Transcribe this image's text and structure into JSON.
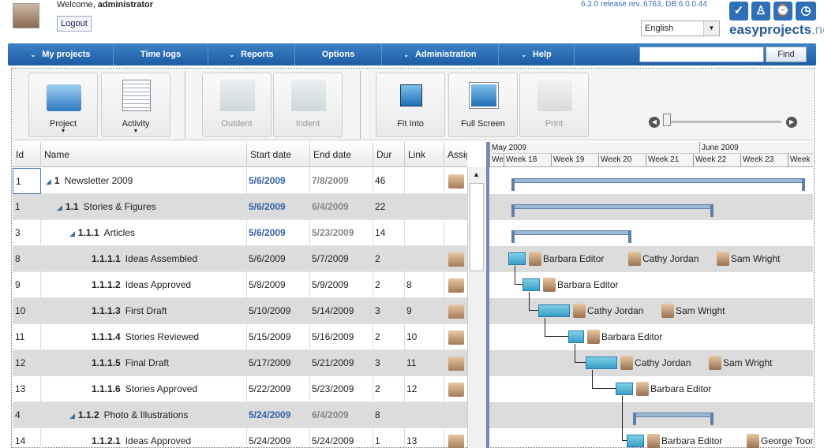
{
  "header": {
    "welcome_prefix": "Welcome, ",
    "user": "administrator",
    "logout": "Logout",
    "release": "6.2.0 release rev.:6763, DB:6.0.0.44",
    "language": "English",
    "brand_main": "easyprojects",
    "brand_tld": ".net"
  },
  "nav": {
    "items": [
      "My projects",
      "Time logs",
      "Reports",
      "Options",
      "Administration",
      "Help"
    ],
    "find": "Find",
    "search_value": ""
  },
  "toolbar": {
    "project": "Project",
    "activity": "Activity",
    "outdent": "Outdent",
    "indent": "Indent",
    "fit_into": "Fit Into",
    "full_screen": "Full Screen",
    "print": "Print"
  },
  "grid": {
    "headers": {
      "id": "Id",
      "name": "Name",
      "start": "Start date",
      "end": "End date",
      "dur": "Dur",
      "link": "Link",
      "assign": "Assig"
    },
    "rows": [
      {
        "id": "1",
        "wbs": "1",
        "name": "Newsletter 2009",
        "start": "5/6/2009",
        "end": "7/8/2009",
        "dur": "46",
        "link": "",
        "level": 0,
        "summary": true
      },
      {
        "id": "1",
        "wbs": "1.1",
        "name": "Stories & Figures",
        "start": "5/6/2009",
        "end": "6/4/2009",
        "dur": "22",
        "link": "",
        "level": 1,
        "summary": true
      },
      {
        "id": "3",
        "wbs": "1.1.1",
        "name": "Articles",
        "start": "5/6/2009",
        "end": "5/23/2009",
        "dur": "14",
        "link": "",
        "level": 2,
        "summary": true
      },
      {
        "id": "8",
        "wbs": "1.1.1.1",
        "name": "Ideas Assembled",
        "start": "5/6/2009",
        "end": "5/7/2009",
        "dur": "2",
        "link": "",
        "level": 3,
        "summary": false
      },
      {
        "id": "9",
        "wbs": "1.1.1.2",
        "name": "Ideas Approved",
        "start": "5/8/2009",
        "end": "5/9/2009",
        "dur": "2",
        "link": "8",
        "level": 3,
        "summary": false
      },
      {
        "id": "10",
        "wbs": "1.1.1.3",
        "name": "First Draft",
        "start": "5/10/2009",
        "end": "5/14/2009",
        "dur": "3",
        "link": "9",
        "level": 3,
        "summary": false
      },
      {
        "id": "11",
        "wbs": "1.1.1.4",
        "name": "Stories Reviewed",
        "start": "5/15/2009",
        "end": "5/16/2009",
        "dur": "2",
        "link": "10",
        "level": 3,
        "summary": false
      },
      {
        "id": "12",
        "wbs": "1.1.1.5",
        "name": "Final Draft",
        "start": "5/17/2009",
        "end": "5/21/2009",
        "dur": "3",
        "link": "11",
        "level": 3,
        "summary": false
      },
      {
        "id": "13",
        "wbs": "1.1.1.6",
        "name": "Stories Approved",
        "start": "5/22/2009",
        "end": "5/23/2009",
        "dur": "2",
        "link": "12",
        "level": 3,
        "summary": false
      },
      {
        "id": "4",
        "wbs": "1.1.2",
        "name": "Photo & Illustrations",
        "start": "5/24/2009",
        "end": "6/4/2009",
        "dur": "8",
        "link": "",
        "level": 2,
        "summary": true
      },
      {
        "id": "14",
        "wbs": "1.1.2.1",
        "name": "Ideas Approved",
        "start": "5/24/2009",
        "end": "5/24/2009",
        "dur": "1",
        "link": "13",
        "level": 3,
        "summary": false
      }
    ]
  },
  "gantt": {
    "months": [
      "May 2009",
      "June 2009"
    ],
    "weeks": [
      "We",
      "Week 18",
      "Week 19",
      "Week 20",
      "Week 21",
      "Week 22",
      "Week 23",
      "Week"
    ],
    "assignees": [
      [
        "Barbara Editor",
        "Cathy Jordan",
        "Sam Wright"
      ],
      [
        "Barbara Editor"
      ],
      [
        "Cathy Jordan",
        "Sam Wright"
      ],
      [
        "Barbara Editor"
      ],
      [
        "Cathy Jordan",
        "Sam Wright"
      ],
      [
        "Barbara Editor"
      ],
      [
        "Barbara Editor",
        "George Toone"
      ]
    ]
  }
}
